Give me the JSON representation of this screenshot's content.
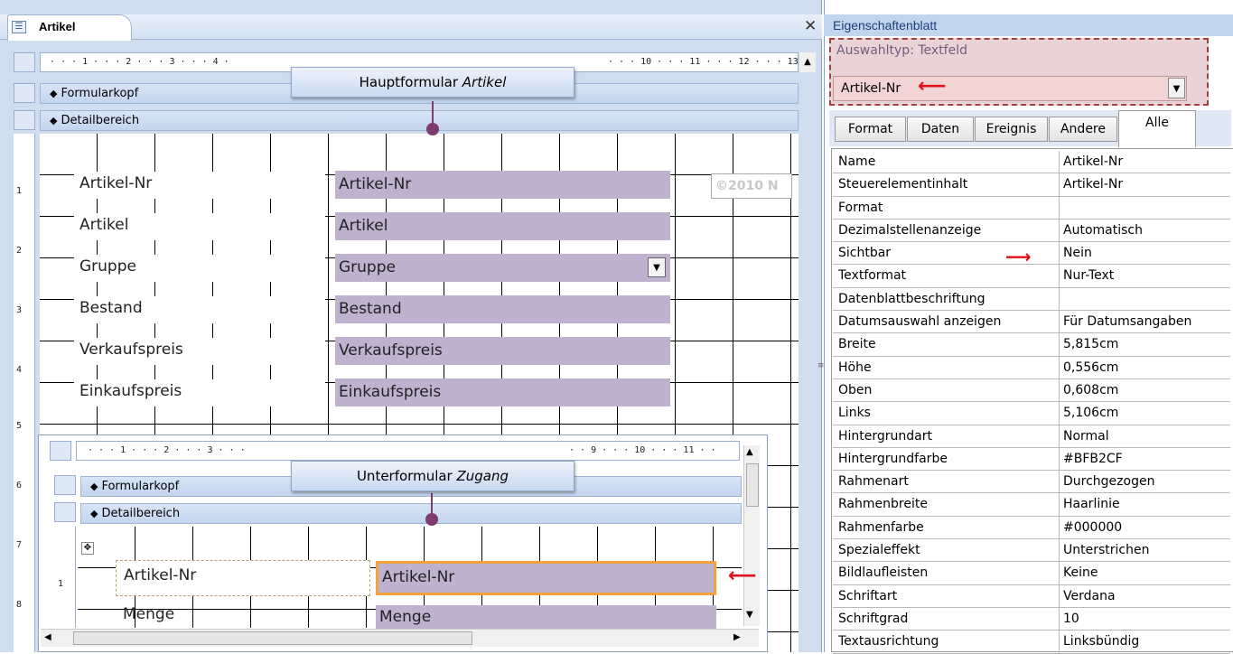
{
  "form_tab": {
    "label": "Artikel",
    "close": "✕"
  },
  "main_form": {
    "ruler_text": "· · · 1 · · · 2 · · · 3 · · · 4 ·",
    "ruler_text_right": "· · · 10 · · · 11 · · · 12 · · · 13",
    "bands": {
      "header": "Formularkopf",
      "detail": "Detailbereich"
    },
    "callout": {
      "prefix": "Hauptformular ",
      "name": "Artikel"
    },
    "labels": [
      "Artikel-Nr",
      "Artikel",
      "Gruppe",
      "Bestand",
      "Verkaufspreis",
      "Einkaufspreis"
    ],
    "fields": [
      "Artikel-Nr",
      "Artikel",
      "Gruppe",
      "Bestand",
      "Verkaufspreis",
      "Einkaufspreis"
    ],
    "copyright": "©2010 N",
    "vruler_numbers": [
      "1",
      "2",
      "3",
      "4",
      "5",
      "6",
      "7",
      "8"
    ]
  },
  "sub_form": {
    "ruler_text": "· · · 1 · · · 2 · · · 3 · · ·",
    "ruler_text_right": "· · 9 · · · 10 · · · 11 · ·",
    "bands": {
      "header": "Formularkopf",
      "detail": "Detailbereich"
    },
    "callout": {
      "prefix": "Unterformular ",
      "name": "Zugang"
    },
    "labels": [
      "Artikel-Nr",
      "Menge"
    ],
    "fields": [
      "Artikel-Nr",
      "Menge"
    ],
    "vruler_numbers": [
      "1"
    ]
  },
  "property_sheet": {
    "title": "Eigenschaftenblatt",
    "selection_type": "Auswahltyp: Textfeld",
    "selected_object": "Artikel-Nr",
    "tabs": [
      "Format",
      "Daten",
      "Ereignis",
      "Andere",
      "Alle"
    ],
    "active_tab": "Alle",
    "rows": [
      {
        "k": "Name",
        "v": "Artikel-Nr"
      },
      {
        "k": "Steuerelementinhalt",
        "v": "Artikel-Nr"
      },
      {
        "k": "Format",
        "v": ""
      },
      {
        "k": "Dezimalstellenanzeige",
        "v": "Automatisch"
      },
      {
        "k": "Sichtbar",
        "v": "Nein"
      },
      {
        "k": "Textformat",
        "v": "Nur-Text"
      },
      {
        "k": "Datenblattbeschriftung",
        "v": ""
      },
      {
        "k": "Datumsauswahl anzeigen",
        "v": "Für Datumsangaben"
      },
      {
        "k": "Breite",
        "v": "5,815cm"
      },
      {
        "k": "Höhe",
        "v": "0,556cm"
      },
      {
        "k": "Oben",
        "v": "0,608cm"
      },
      {
        "k": "Links",
        "v": "5,106cm"
      },
      {
        "k": "Hintergrundart",
        "v": "Normal"
      },
      {
        "k": "Hintergrundfarbe",
        "v": "#BFB2CF"
      },
      {
        "k": "Rahmenart",
        "v": "Durchgezogen"
      },
      {
        "k": "Rahmenbreite",
        "v": "Haarlinie"
      },
      {
        "k": "Rahmenfarbe",
        "v": "#000000"
      },
      {
        "k": "Spezialeffekt",
        "v": "Unterstrichen"
      },
      {
        "k": "Bildlaufleisten",
        "v": "Keine"
      },
      {
        "k": "Schriftart",
        "v": "Verdana"
      },
      {
        "k": "Schriftgrad",
        "v": "10"
      },
      {
        "k": "Textausrichtung",
        "v": "Linksbündig"
      }
    ]
  },
  "colors": {
    "field_bg": "#BFB2CF",
    "selection": "#F5A33A",
    "arrow": "#E0101A",
    "callout_pin": "#7D3B6F"
  }
}
